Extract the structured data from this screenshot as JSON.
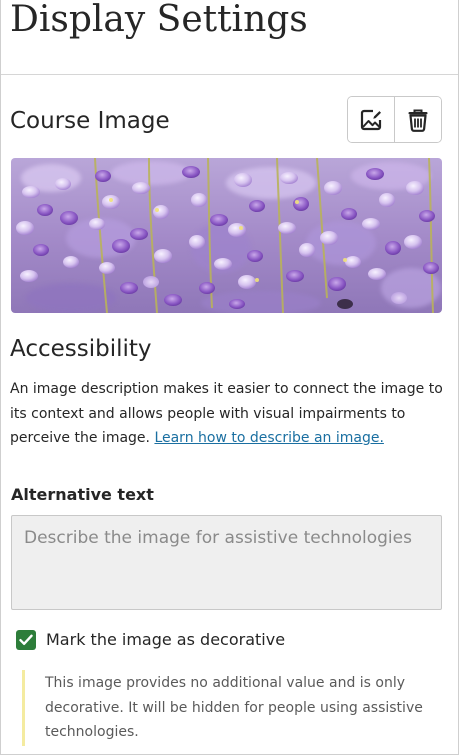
{
  "page": {
    "title": "Display Settings"
  },
  "course_image": {
    "title": "Course Image",
    "change_button_icon": "image-edit-icon",
    "delete_button_icon": "trash-icon",
    "preview_icon": "wisteria-photo"
  },
  "accessibility": {
    "title": "Accessibility",
    "description": "An image description makes it easier to connect the image to its context and allows people with visual impairments to perceive the image.",
    "link_text": "Learn how to describe an image."
  },
  "alt_text": {
    "label": "Alternative text",
    "value": "",
    "placeholder": "Describe the image for assistive technologies"
  },
  "decorative": {
    "checked": true,
    "label": "Mark the image as decorative",
    "note": "This image provides no additional value and is only decorative. It will be hidden for people using assistive technologies."
  },
  "colors": {
    "checkbox": "#2d7d3a",
    "link": "#1a6fa1",
    "note_bar": "#f4eba0",
    "input_bg": "#efefef"
  }
}
